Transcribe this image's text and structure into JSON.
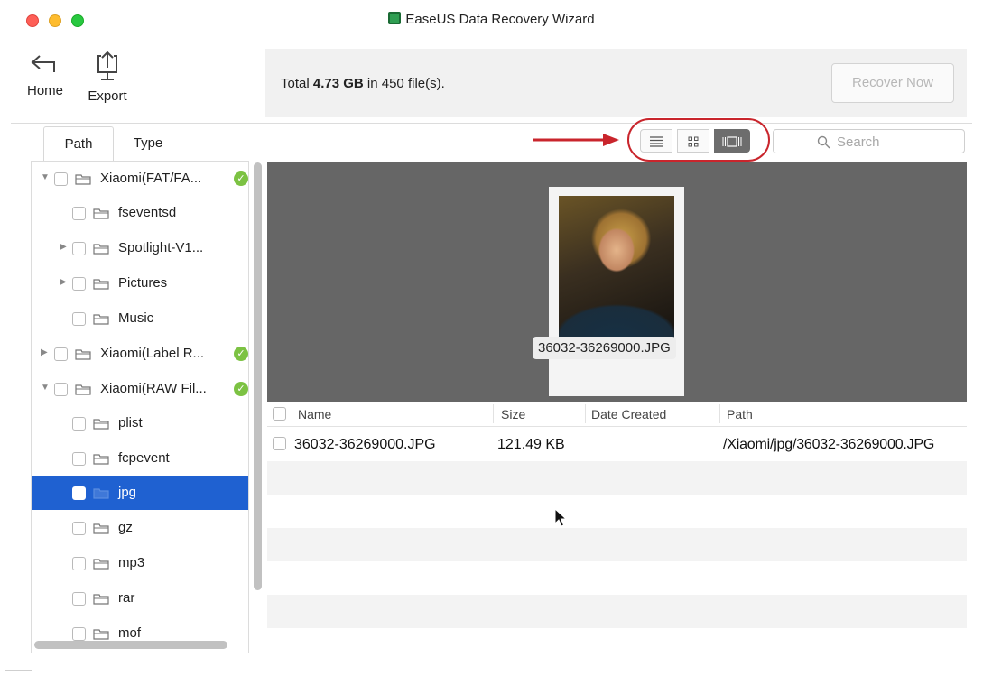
{
  "window": {
    "title": "EaseUS Data Recovery Wizard"
  },
  "toolbar": {
    "home_label": "Home",
    "export_label": "Export",
    "summary": {
      "prefix": "Total",
      "size": "4.73 GB",
      "suffix": "in 450 file(s)."
    },
    "recover_label": "Recover Now"
  },
  "tabs": {
    "path": "Path",
    "type": "Type"
  },
  "tree": [
    {
      "label": "Xiaomi(FAT/FA...",
      "expanded": true,
      "verified": true
    },
    {
      "label": "fseventsd"
    },
    {
      "label": "Spotlight-V1...",
      "collapsed": true
    },
    {
      "label": "Pictures",
      "collapsed": true
    },
    {
      "label": "Music"
    },
    {
      "label": "Xiaomi(Label R...",
      "collapsed": true,
      "verified": true
    },
    {
      "label": "Xiaomi(RAW Fil...",
      "expanded": true,
      "verified": true
    },
    {
      "label": "plist"
    },
    {
      "label": "fcpevent"
    },
    {
      "label": "jpg",
      "selected": true
    },
    {
      "label": "gz"
    },
    {
      "label": "mp3"
    },
    {
      "label": "rar"
    },
    {
      "label": "mof"
    }
  ],
  "view": {
    "modes": [
      "list-view-icon",
      "grid-view-icon",
      "cover-flow-icon"
    ],
    "active": "cover-flow-icon",
    "search_placeholder": "Search"
  },
  "preview": {
    "caption": "36032-36269000.JPG"
  },
  "file_list": {
    "columns": [
      "Name",
      "Size",
      "Date Created",
      "Path"
    ],
    "rows": [
      {
        "name": "36032-36269000.JPG",
        "size": "121.49 KB",
        "date": "",
        "path": "/Xiaomi/jpg/36032-36269000.JPG"
      }
    ]
  },
  "colors": {
    "selection": "#1f61d1",
    "annotation": "#c9252c",
    "verified": "#7cc243",
    "preview_bg": "#666666"
  }
}
